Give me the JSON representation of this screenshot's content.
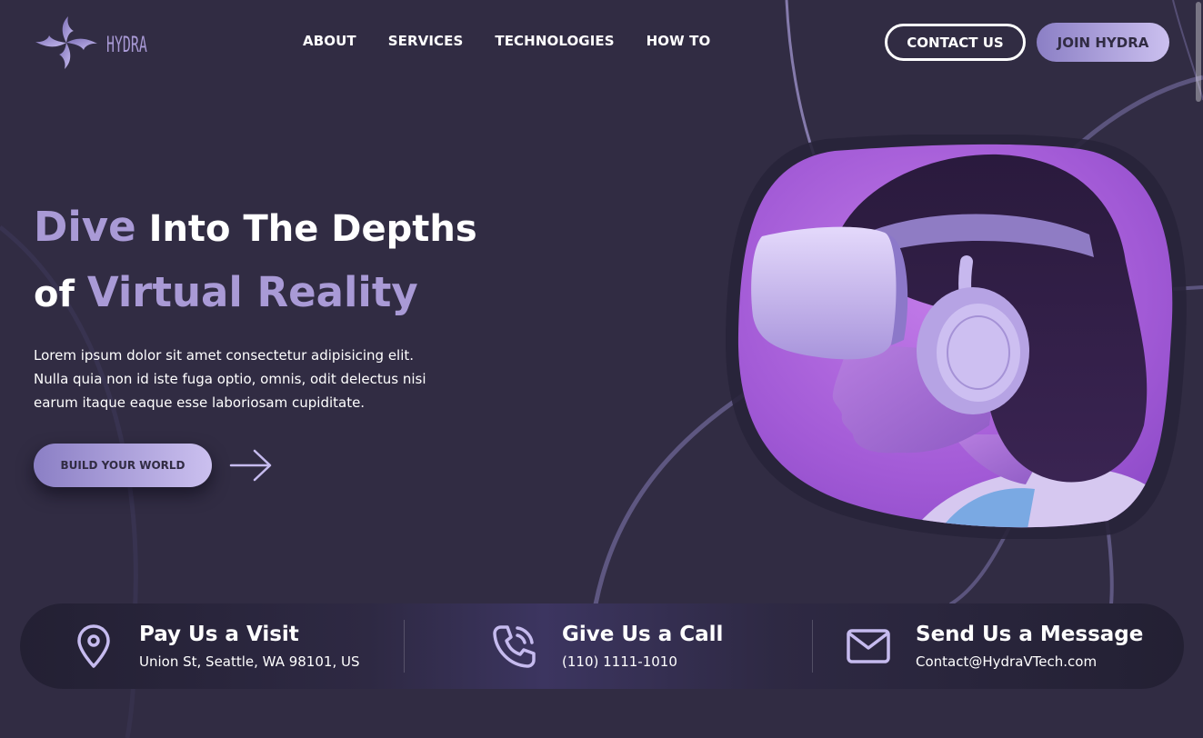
{
  "brand": {
    "name": "HYDRA",
    "logo_icon": "hydra-swirl-icon"
  },
  "nav": {
    "items": [
      {
        "label": "ABOUT"
      },
      {
        "label": "SERVICES"
      },
      {
        "label": "TECHNOLOGIES"
      },
      {
        "label": "HOW TO"
      }
    ],
    "contact_label": "CONTACT US",
    "join_label": "JOIN HYDRA"
  },
  "hero": {
    "title_accent_1": "Dive",
    "title_rest_1": " Into The Depths",
    "title_prefix_2": "of ",
    "title_accent_2": "Virtual Reality",
    "description": "Lorem ipsum dolor sit amet consectetur adipisicing elit. Nulla quia non id iste fuga optio, omnis, odit delectus nisi earum itaque eaque esse laboriosam cupiditate.",
    "cta_label": "BUILD YOUR WORLD",
    "cta_arrow_icon": "arrow-right-icon",
    "image_subject": "person-wearing-vr-headset"
  },
  "contact": {
    "visit": {
      "title": "Pay Us a Visit",
      "value": "Union St, Seattle, WA 98101, US",
      "icon": "map-pin-icon"
    },
    "call": {
      "title": "Give Us a Call",
      "value": "(110) 1111-1010",
      "icon": "phone-icon"
    },
    "message": {
      "title": "Send Us a Message",
      "value": "Contact@HydraVTech.com",
      "icon": "mail-icon"
    }
  },
  "colors": {
    "background": "#312c43",
    "accent": "#a99ad6",
    "accent_light": "#cbc0ef",
    "image_purple": "#a55fd6"
  }
}
